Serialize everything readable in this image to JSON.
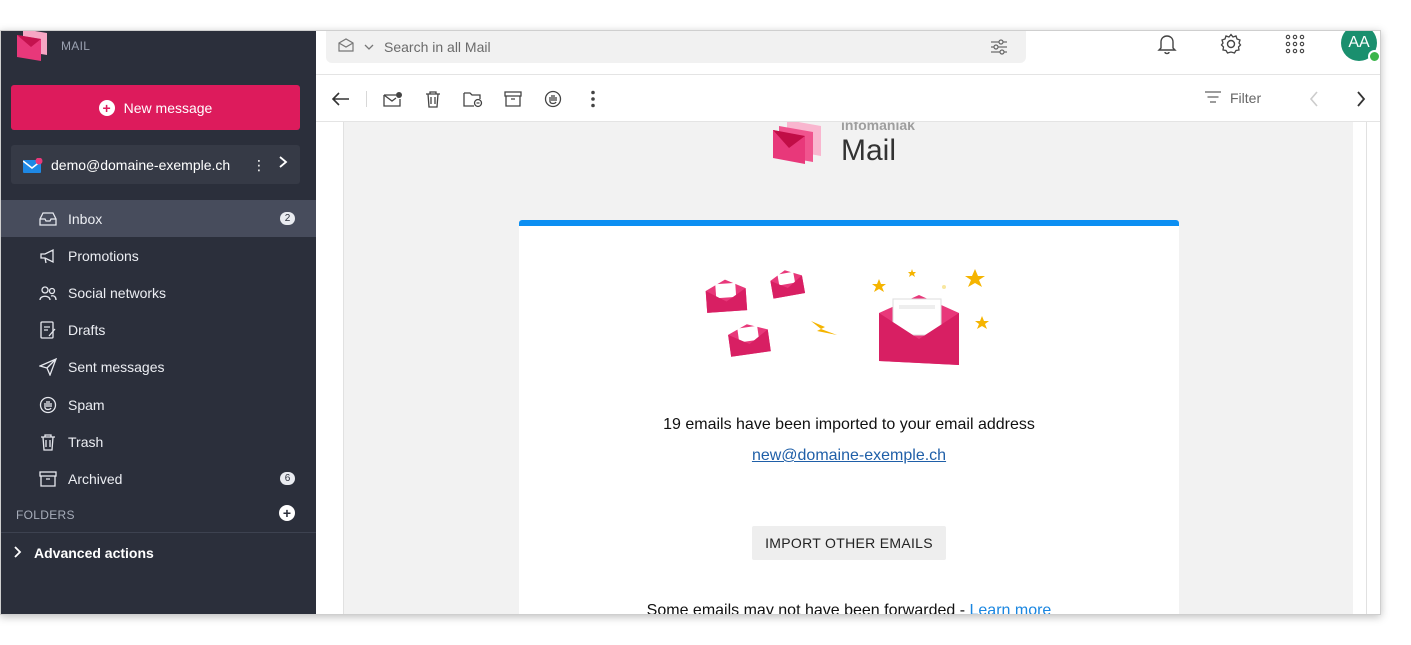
{
  "brand": {
    "name": "infomaniak",
    "product": "MAIL"
  },
  "sidebar": {
    "new_message": "New message",
    "account": "demo@domaine-exemple.ch",
    "items": [
      {
        "label": "Inbox",
        "icon": "inbox-icon",
        "badge": "2"
      },
      {
        "label": "Promotions",
        "icon": "megaphone-icon",
        "badge": ""
      },
      {
        "label": "Social networks",
        "icon": "people-icon",
        "badge": ""
      },
      {
        "label": "Drafts",
        "icon": "draft-icon",
        "badge": ""
      },
      {
        "label": "Sent messages",
        "icon": "send-icon",
        "badge": ""
      },
      {
        "label": "Spam",
        "icon": "spam-hand-icon",
        "badge": ""
      },
      {
        "label": "Trash",
        "icon": "trash-icon",
        "badge": ""
      },
      {
        "label": "Archived",
        "icon": "archive-icon",
        "badge": "6"
      }
    ],
    "folders_label": "FOLDERS",
    "advanced_actions": "Advanced actions"
  },
  "search": {
    "placeholder": "Search in all Mail"
  },
  "toolbar": {
    "filter_label": "Filter"
  },
  "email": {
    "company": "infomaniak",
    "product": "Mail",
    "message": "19 emails have been imported to your email address",
    "address": "new@domaine-exemple.ch",
    "button": "IMPORT OTHER EMAILS",
    "note": "Some emails may not have been forwarded - ",
    "learn_more": "Learn more"
  },
  "user": {
    "initials": "AA"
  },
  "colors": {
    "accent": "#dd1b5c",
    "sidebar": "#2b2f3b",
    "blue": "#0c8ff2",
    "avatar": "#1a8f6e"
  }
}
